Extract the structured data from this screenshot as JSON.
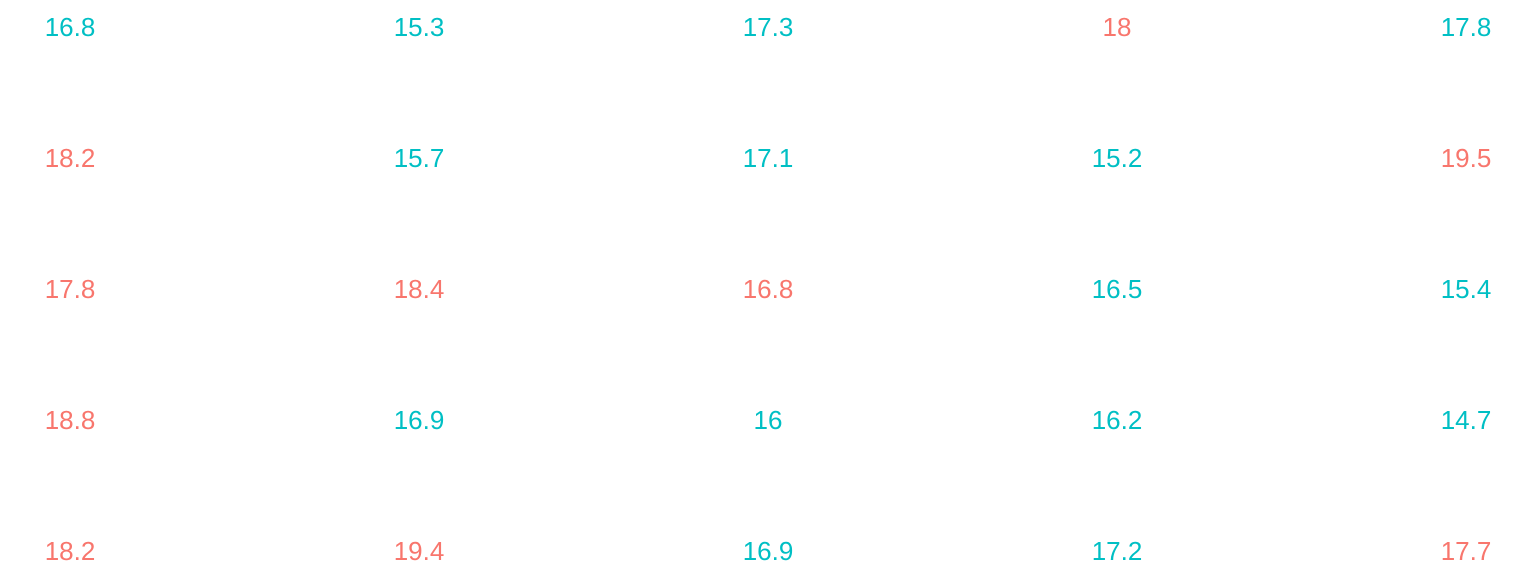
{
  "colors": {
    "low": "#00BFC4",
    "high": "#F8766D"
  },
  "chart_data": {
    "type": "table",
    "title": "",
    "xlabel": "",
    "ylabel": "",
    "grid": false,
    "legend": "none",
    "rows": [
      {
        "values": [
          "16.8",
          "15.3",
          "17.3",
          "18",
          "17.8"
        ],
        "groups": [
          "low",
          "low",
          "low",
          "high",
          "low"
        ]
      },
      {
        "values": [
          "18.2",
          "15.7",
          "17.1",
          "15.2",
          "19.5"
        ],
        "groups": [
          "high",
          "low",
          "low",
          "low",
          "high"
        ]
      },
      {
        "values": [
          "17.8",
          "18.4",
          "16.8",
          "16.5",
          "15.4"
        ],
        "groups": [
          "high",
          "high",
          "high",
          "low",
          "low"
        ]
      },
      {
        "values": [
          "18.8",
          "16.9",
          "16",
          "16.2",
          "14.7"
        ],
        "groups": [
          "high",
          "low",
          "low",
          "low",
          "low"
        ]
      },
      {
        "values": [
          "18.2",
          "19.4",
          "16.9",
          "17.2",
          "17.7"
        ],
        "groups": [
          "high",
          "high",
          "low",
          "low",
          "high"
        ]
      }
    ]
  }
}
